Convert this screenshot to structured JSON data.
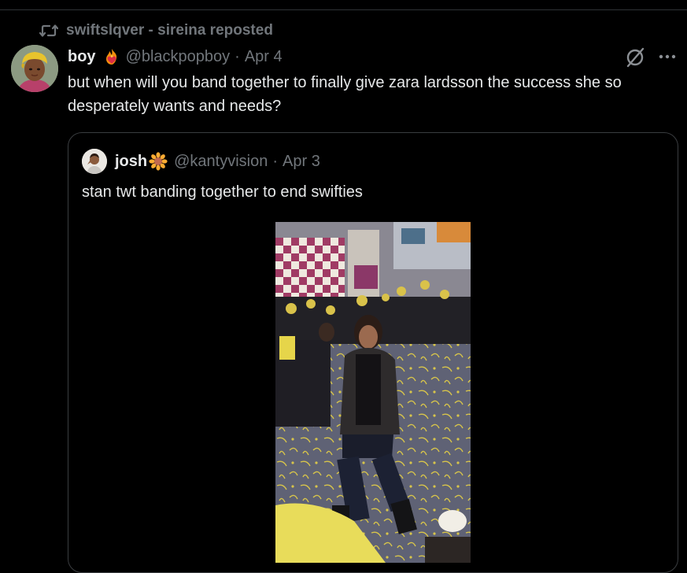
{
  "repost": {
    "label": "swiftslqver - sireina reposted",
    "icon": "repost-icon"
  },
  "post": {
    "author": {
      "display_name": "boy",
      "badge": "heart-on-fire-emoji",
      "handle": "@blackpopboy"
    },
    "separator": "·",
    "date": "Apr 4",
    "text": "but when will you band together to finally give zara lardsson the success she so desperately wants and needs?",
    "actions": [
      "grok-icon",
      "more-icon"
    ]
  },
  "quote": {
    "author": {
      "display_name": "josh",
      "badge": "sunflower-emoji",
      "handle": "@kantyvision"
    },
    "separator": "·",
    "date": "Apr 3",
    "text": "stan twt banding together to end swifties",
    "media": {
      "type": "video-frame",
      "description_icon": "video-thumbnail"
    }
  },
  "colors": {
    "background": "#000000",
    "text_primary": "#e7e9ea",
    "text_secondary": "#71767b",
    "border": "#2f3336"
  }
}
